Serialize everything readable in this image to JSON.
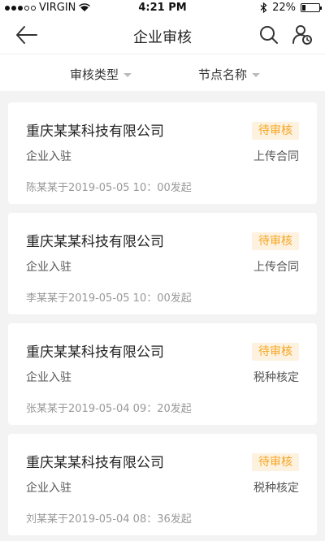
{
  "status_bar": {
    "carrier": "VIRGIN",
    "time": "4:21 PM",
    "battery_percent": "22%",
    "battery_level": 0.22,
    "signal_bars_filled": 3
  },
  "nav": {
    "title": "企业审核",
    "back_icon": "back-arrow-icon",
    "search_icon": "search-icon",
    "user_icon": "user-review-icon"
  },
  "filters": {
    "type_label": "审核类型",
    "node_label": "节点名称"
  },
  "colors": {
    "badge_text": "#f5a623",
    "badge_bg": "#fdf1df",
    "background": "#f3f3f3"
  },
  "cards": [
    {
      "company": "重庆某某科技有限公司",
      "type": "企业入驻",
      "status": "待审核",
      "node": "上传合同",
      "meta": "陈某某于2019-05-05 10：00发起"
    },
    {
      "company": "重庆某某科技有限公司",
      "type": "企业入驻",
      "status": "待审核",
      "node": "上传合同",
      "meta": "李某某于2019-05-05 10：00发起"
    },
    {
      "company": "重庆某某科技有限公司",
      "type": "企业入驻",
      "status": "待审核",
      "node": "税种核定",
      "meta": "张某某于2019-05-04 09：20发起"
    },
    {
      "company": "重庆某某科技有限公司",
      "type": "企业入驻",
      "status": "待审核",
      "node": "税种核定",
      "meta": "刘某某于2019-05-04 08：36发起"
    }
  ]
}
